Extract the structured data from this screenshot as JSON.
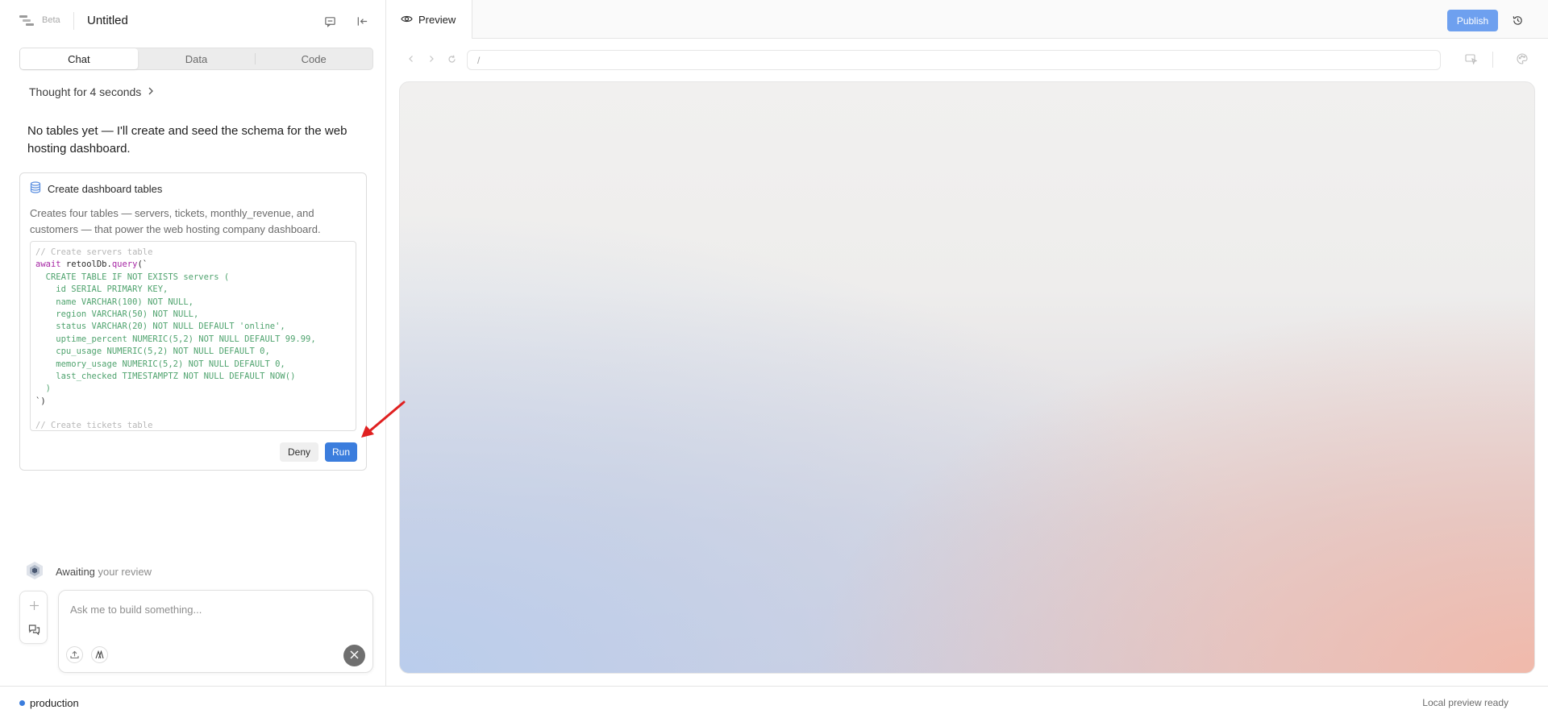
{
  "header": {
    "beta_label": "Beta",
    "title": "Untitled",
    "icons": [
      "logo-icon",
      "chat-bubble-icon",
      "collapse-panel-icon"
    ]
  },
  "tabs": [
    {
      "label": "Chat",
      "active": true
    },
    {
      "label": "Data",
      "active": false
    },
    {
      "label": "Code",
      "active": false
    }
  ],
  "chat": {
    "thought": "Thought for 4 seconds",
    "message": "No tables yet — I'll create and seed the schema for the web hosting dashboard.",
    "tool": {
      "title": "Create dashboard tables",
      "icon": "database-icon",
      "description": "Creates four tables — servers, tickets, monthly_revenue, and customers — that power the web hosting company dashboard.",
      "code_lines": [
        [
          {
            "t": "// Create servers table",
            "c": "comment"
          }
        ],
        [
          {
            "t": "await",
            "c": "kw"
          },
          {
            "t": " retoolDb.",
            "c": "plain"
          },
          {
            "t": "query",
            "c": "fn"
          },
          {
            "t": "(`",
            "c": "plain"
          }
        ],
        [
          {
            "t": "  CREATE TABLE IF NOT EXISTS servers (",
            "c": "str"
          }
        ],
        [
          {
            "t": "    id SERIAL PRIMARY KEY,",
            "c": "str"
          }
        ],
        [
          {
            "t": "    name VARCHAR(100) NOT NULL,",
            "c": "str"
          }
        ],
        [
          {
            "t": "    region VARCHAR(50) NOT NULL,",
            "c": "str"
          }
        ],
        [
          {
            "t": "    status VARCHAR(20) NOT NULL DEFAULT 'online',",
            "c": "str"
          }
        ],
        [
          {
            "t": "    uptime_percent NUMERIC(5,2) NOT NULL DEFAULT 99.99,",
            "c": "str"
          }
        ],
        [
          {
            "t": "    cpu_usage NUMERIC(5,2) NOT NULL DEFAULT 0,",
            "c": "str"
          }
        ],
        [
          {
            "t": "    memory_usage NUMERIC(5,2) NOT NULL DEFAULT 0,",
            "c": "str"
          }
        ],
        [
          {
            "t": "    last_checked TIMESTAMPTZ NOT NULL DEFAULT NOW()",
            "c": "str"
          }
        ],
        [
          {
            "t": "  )",
            "c": "str"
          }
        ],
        [
          {
            "t": "`)",
            "c": "plain"
          }
        ],
        [
          {
            "t": "",
            "c": "plain"
          }
        ],
        [
          {
            "t": "// Create tickets table",
            "c": "comment"
          }
        ]
      ],
      "deny_label": "Deny",
      "run_label": "Run"
    },
    "status_prefix": "Awaiting",
    "status_suffix": " your review",
    "composer_placeholder": "Ask me to build something..."
  },
  "preview": {
    "tab_label": "Preview",
    "publish_label": "Publish",
    "url": "/"
  },
  "statusbar": {
    "environment": "production",
    "status": "Local preview ready"
  },
  "colors": {
    "accent": "#3b7ddd",
    "publish": "#6ea0ef",
    "code_string": "#4fa36e",
    "code_keyword": "#a626a4",
    "annotation_arrow": "#e02020"
  }
}
